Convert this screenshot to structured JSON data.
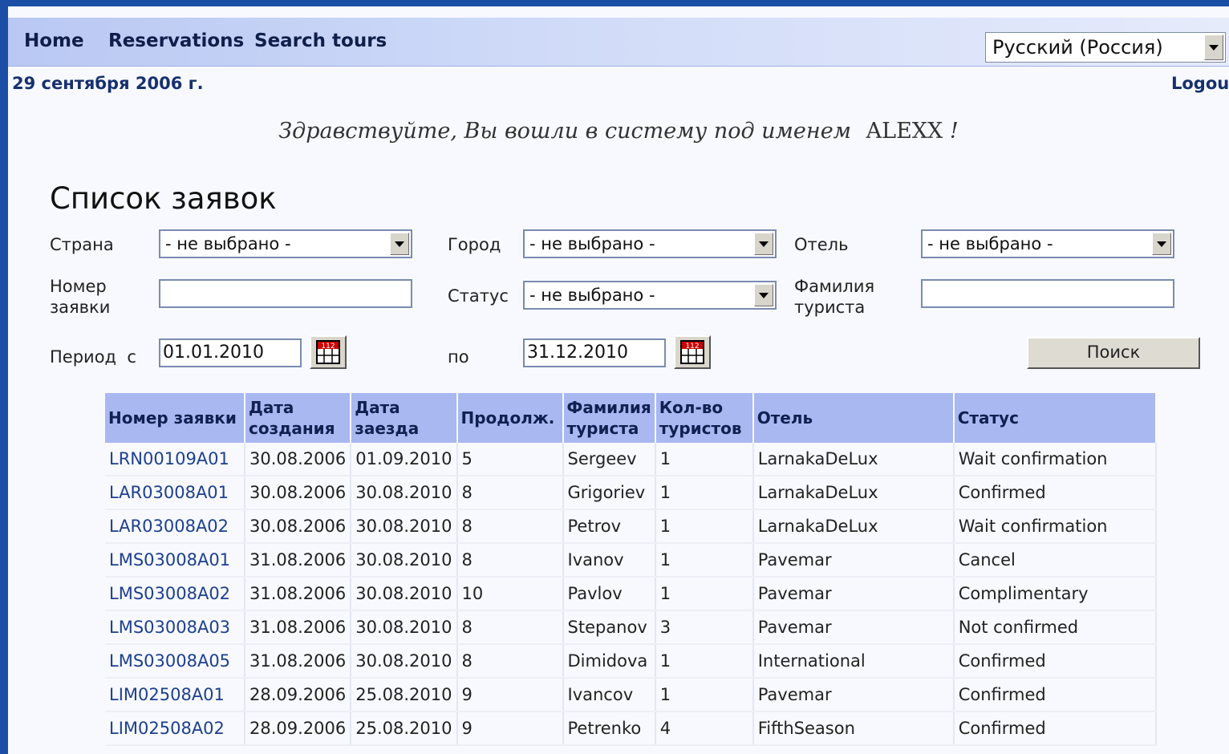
{
  "nav": {
    "home": "Home",
    "reservations": "Reservations",
    "search_tours": "Search tours"
  },
  "language": {
    "selected": "Русский (Россия)"
  },
  "date": "29 сентября 2006 г.",
  "logout": "Logout",
  "welcome": {
    "text": "Здравствуйте, Вы вошли в систему под именем",
    "user": "ALEXX",
    "suffix": "!"
  },
  "page_title": "Список заявок",
  "filters": {
    "country_label": "Страна",
    "country_value": "- не выбрано -",
    "city_label": "Город",
    "city_value": "- не выбрано -",
    "hotel_label": "Отель",
    "hotel_value": "- не выбрано -",
    "order_label_1": "Номер",
    "order_label_2": "заявки",
    "order_value": "",
    "status_label": "Статус",
    "status_value": "- не выбрано -",
    "tourist_label_1": "Фамилия",
    "tourist_label_2": "туриста",
    "tourist_value": "",
    "period_label": "Период  с",
    "date_from": "01.01.2010",
    "to_label": "по",
    "date_to": "31.12.2010",
    "search_button": "Поиск"
  },
  "table": {
    "headers": [
      [
        "Номер заявки"
      ],
      [
        "Дата",
        "создания"
      ],
      [
        "Дата",
        "заезда"
      ],
      [
        "Продолж."
      ],
      [
        "Фамилия",
        "туриста"
      ],
      [
        "Кол-во",
        "туристов"
      ],
      [
        "Отель"
      ],
      [
        "Статус"
      ]
    ],
    "rows": [
      [
        "LRN00109A01",
        "30.08.2006",
        "01.09.2010",
        "5",
        "Sergeev",
        "1",
        "LarnakaDeLux",
        "Wait confirmation"
      ],
      [
        "LAR03008A01",
        "30.08.2006",
        "30.08.2010",
        "8",
        "Grigoriev",
        "1",
        "LarnakaDeLux",
        "Confirmed"
      ],
      [
        "LAR03008A02",
        "30.08.2006",
        "30.08.2010",
        "8",
        "Petrov",
        "1",
        "LarnakaDeLux",
        "Wait confirmation"
      ],
      [
        "LMS03008A01",
        "31.08.2006",
        "30.08.2010",
        "8",
        "Ivanov",
        "1",
        "Pavemar",
        "Cancel"
      ],
      [
        "LMS03008A02",
        "31.08.2006",
        "30.08.2010",
        "10",
        "Pavlov",
        "1",
        "Pavemar",
        "Complimentary"
      ],
      [
        "LMS03008A03",
        "31.08.2006",
        "30.08.2010",
        "8",
        "Stepanov",
        "3",
        "Pavemar",
        "Not confirmed"
      ],
      [
        "LMS03008A05",
        "31.08.2006",
        "30.08.2010",
        "8",
        "Dimidova",
        "1",
        "International",
        "Confirmed"
      ],
      [
        "LIM02508A01",
        "28.09.2006",
        "25.08.2010",
        "9",
        "Ivancov",
        "1",
        "Pavemar",
        "Confirmed"
      ],
      [
        "LIM02508A02",
        "28.09.2006",
        "25.08.2010",
        "9",
        "Petrenko",
        "4",
        "FifthSeason",
        "Confirmed"
      ]
    ]
  }
}
